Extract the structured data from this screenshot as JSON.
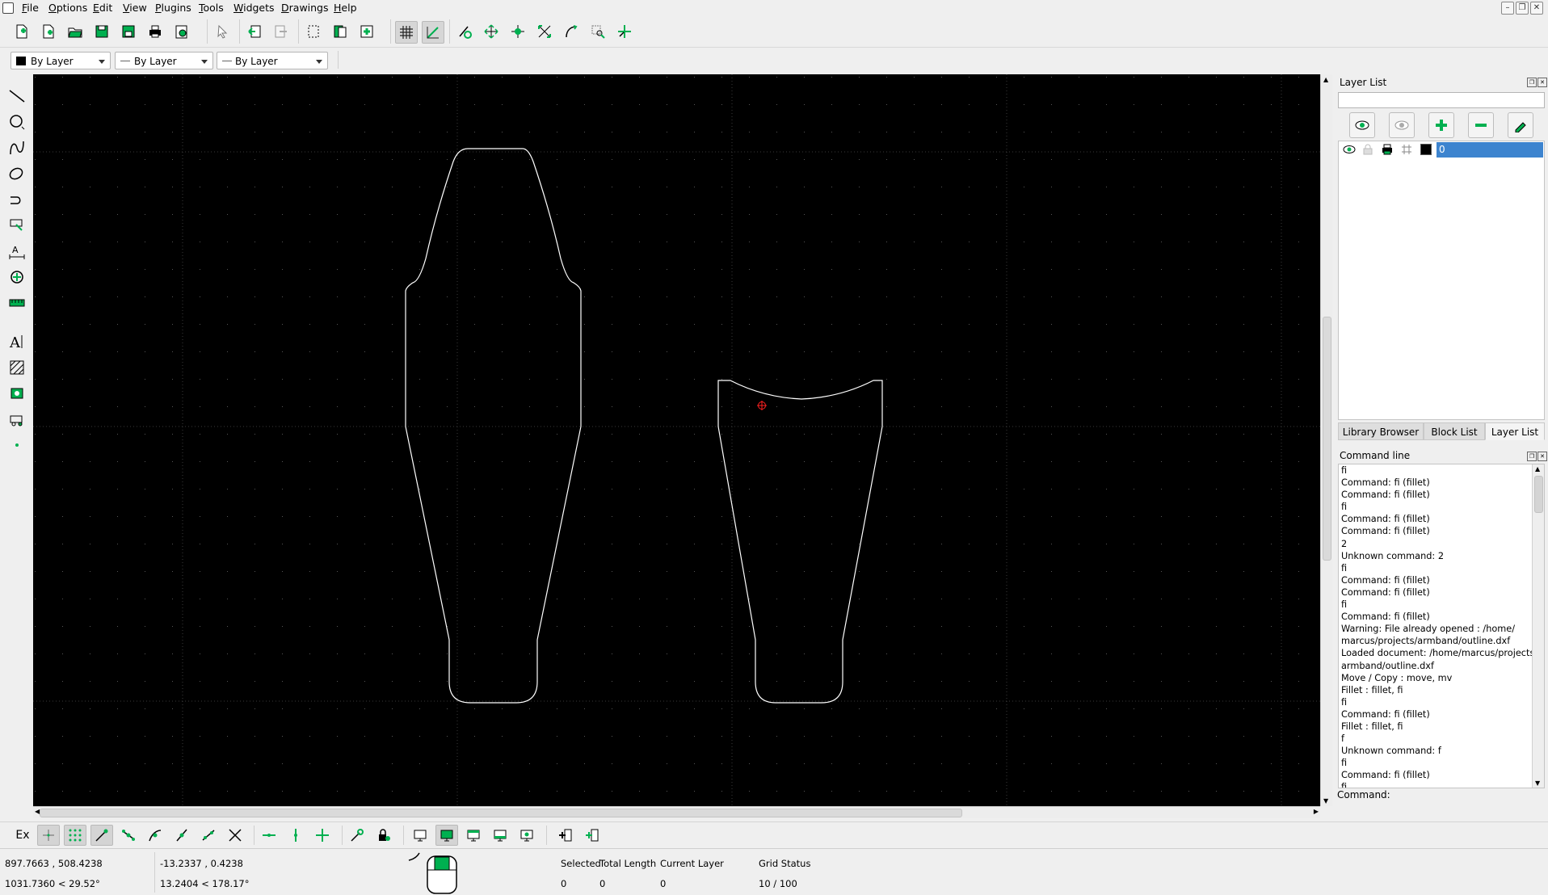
{
  "menu": [
    "File",
    "Options",
    "Edit",
    "View",
    "Plugins",
    "Tools",
    "Widgets",
    "Drawings",
    "Help"
  ],
  "pen": {
    "color": "By Layer",
    "width": "By Layer",
    "type": "By Layer"
  },
  "layer_panel": {
    "title": "Layer List",
    "filter_value": "",
    "layers": [
      {
        "name": "0",
        "color": "#000000"
      }
    ]
  },
  "tabs": [
    "Library Browser",
    "Block List",
    "Layer List"
  ],
  "command_panel": {
    "title": "Command line",
    "lines": [
      "fi",
      "Command: fi (fillet)",
      "Command: fi (fillet)",
      "fi",
      "Command: fi (fillet)",
      "Command: fi (fillet)",
      "2",
      "Unknown command: 2",
      "fi",
      "Command: fi (fillet)",
      "Command: fi (fillet)",
      "fi",
      "Command: fi (fillet)",
      "Warning: File already opened : /home/",
      "marcus/projects/armband/outline.dxf",
      "Loaded document: /home/marcus/projects/",
      "armband/outline.dxf",
      "Move / Copy : move, mv",
      "Fillet : fillet, fi",
      "fi",
      "Command: fi (fillet)",
      "Fillet : fillet, fi",
      "f",
      "Unknown command: f",
      "fi",
      "Command: fi (fillet)",
      "fi"
    ],
    "input_label": "Command:"
  },
  "bottom_toolbar": {
    "ex_label": "Ex"
  },
  "status": {
    "abs_coords": "897.7663 , 508.4238",
    "abs_polar": "1031.7360 < 29.52°",
    "rel_coords": "-13.2337 , 0.4238",
    "rel_polar": "13.2404 < 178.17°",
    "selected_label": "Selected",
    "selected_value": "0",
    "total_length_label": "Total Length",
    "total_length_value": "0",
    "current_layer_label": "Current Layer",
    "current_layer_value": "0",
    "grid_status_label": "Grid Status",
    "grid_status_value": "10 / 100"
  },
  "colors": {
    "accent": "#00b050",
    "selection": "#3d84cf",
    "canvas": "#000000",
    "entity": "#ffffff",
    "cursor": "#ff2020"
  }
}
